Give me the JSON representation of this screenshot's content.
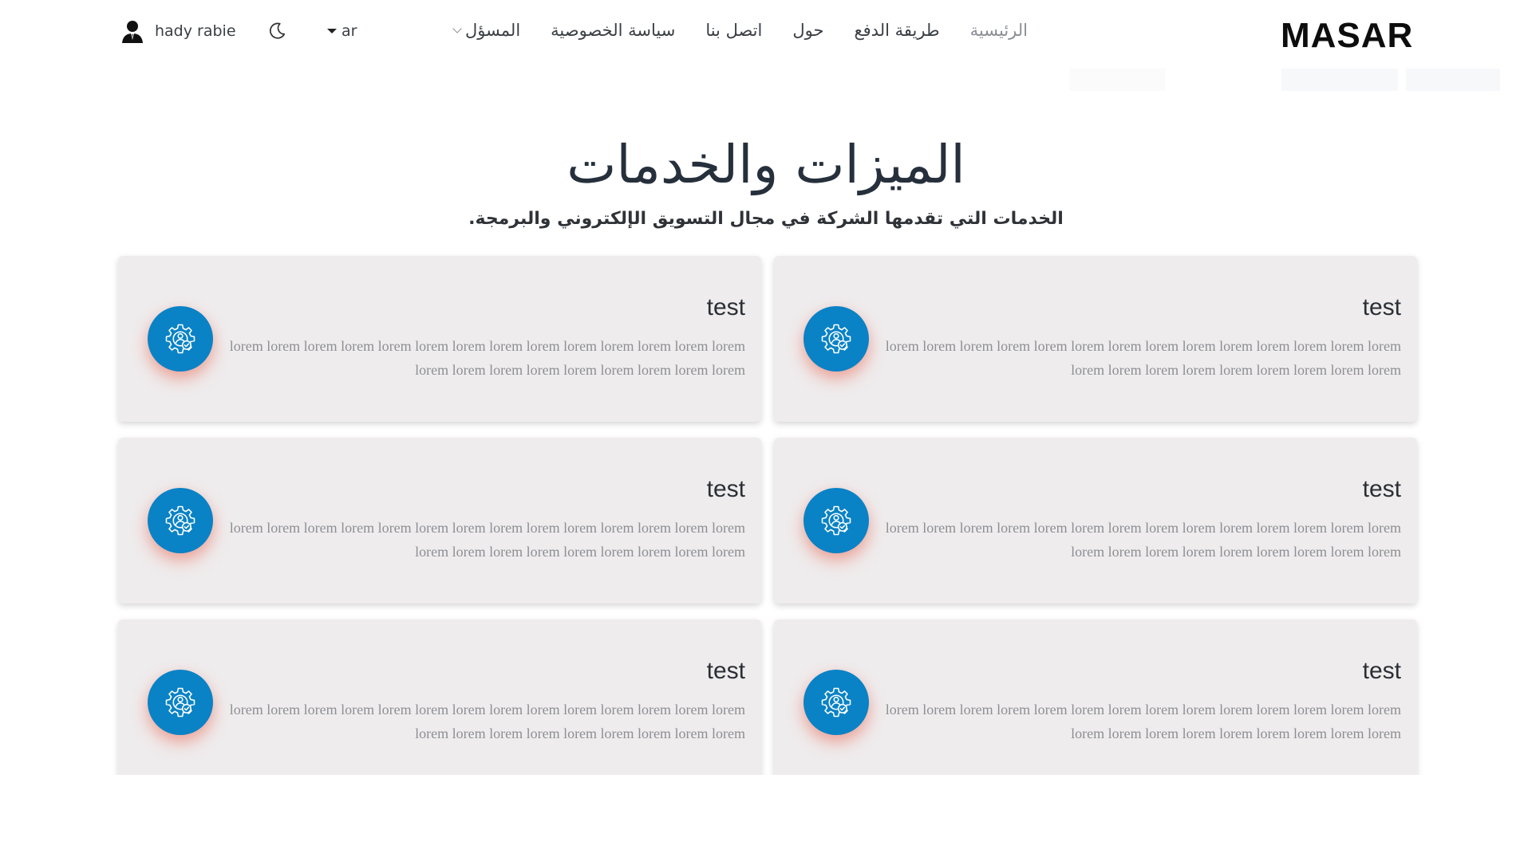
{
  "header": {
    "logo": "MASAR",
    "nav": [
      {
        "label": "الرئيسية",
        "active": true
      },
      {
        "label": "طريقة الدفع",
        "active": false
      },
      {
        "label": "حول",
        "active": false
      },
      {
        "label": "اتصل بنا",
        "active": false
      },
      {
        "label": "سياسة الخصوصية",
        "active": false
      },
      {
        "label": "المسؤل",
        "active": false,
        "dropdown": true
      }
    ],
    "language": "ar",
    "theme_icon": "moon-icon",
    "user": {
      "name": "hady rabie",
      "avatar_icon": "user-avatar-icon"
    }
  },
  "section": {
    "title": "الميزات والخدمات",
    "subtitle": "الخدمات التي تقدمها الشركة في مجال التسويق الإلكتروني والبرمجة.",
    "cards": [
      {
        "title": "test",
        "text": "lorem lorem lorem lorem lorem lorem lorem lorem lorem lorem lorem lorem lorem lorem lorem lorem lorem lorem lorem lorem lorem lorem lorem",
        "icon": "gear-user-check-icon"
      },
      {
        "title": "test",
        "text": "lorem lorem lorem lorem lorem lorem lorem lorem lorem lorem lorem lorem lorem lorem lorem lorem lorem lorem lorem lorem lorem lorem lorem",
        "icon": "gear-user-check-icon"
      },
      {
        "title": "test",
        "text": "lorem lorem lorem lorem lorem lorem lorem lorem lorem lorem lorem lorem lorem lorem lorem lorem lorem lorem lorem lorem lorem lorem lorem",
        "icon": "gear-user-check-icon"
      },
      {
        "title": "test",
        "text": "lorem lorem lorem lorem lorem lorem lorem lorem lorem lorem lorem lorem lorem lorem lorem lorem lorem lorem lorem lorem lorem lorem lorem",
        "icon": "gear-user-check-icon"
      },
      {
        "title": "test",
        "text": "lorem lorem lorem lorem lorem lorem lorem lorem lorem lorem lorem lorem lorem lorem lorem lorem lorem lorem lorem lorem lorem lorem lorem",
        "icon": "gear-user-check-icon"
      },
      {
        "title": "test",
        "text": "lorem lorem lorem lorem lorem lorem lorem lorem lorem lorem lorem lorem lorem lorem lorem lorem lorem lorem lorem lorem lorem lorem lorem",
        "icon": "gear-user-check-icon"
      }
    ]
  },
  "colors": {
    "accent": "#0a82c6",
    "card_bg": "#efeced",
    "glow": "#e75c46"
  }
}
